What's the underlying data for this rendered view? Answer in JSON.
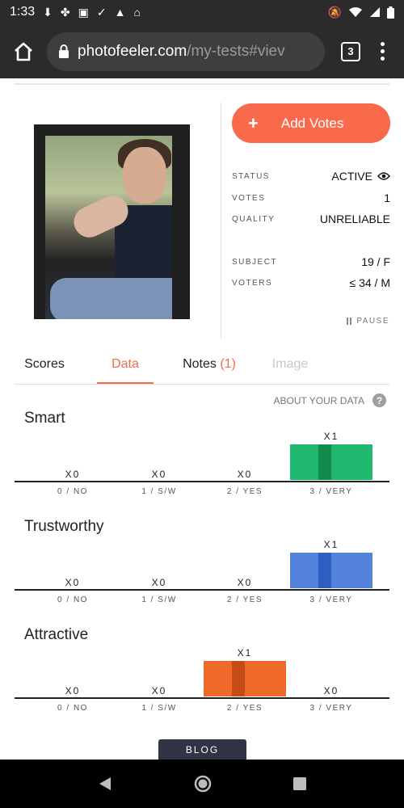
{
  "statusbar": {
    "time": "1:33",
    "icons_left": [
      "download-icon",
      "leaf-icon",
      "image-icon",
      "check-icon",
      "warning-icon",
      "vpn-icon"
    ],
    "icons_right": [
      "mute-icon",
      "wifi-icon",
      "signal-icon",
      "battery-icon"
    ]
  },
  "browser": {
    "url_host": "photofeeler.com",
    "url_path": "/my-tests#viev",
    "tab_count": "3"
  },
  "test": {
    "add_votes_label": "Add Votes",
    "status_label": "STATUS",
    "status_value": "ACTIVE",
    "votes_label": "VOTES",
    "votes_value": "1",
    "quality_label": "QUALITY",
    "quality_value": "UNRELIABLE",
    "subject_label": "SUBJECT",
    "subject_value": "19 / F",
    "voters_label": "VOTERS",
    "voters_value": "≤ 34 / M",
    "pause_label": "PAUSE"
  },
  "tabs": {
    "scores": "Scores",
    "data": "Data",
    "notes": "Notes",
    "notes_count": "(1)",
    "image": "Image"
  },
  "about_data": "ABOUT YOUR DATA",
  "chart_data": [
    {
      "type": "bar",
      "title": "Smart",
      "categories": [
        "0 / NO",
        "1 / S/W",
        "2 / YES",
        "3 / VERY"
      ],
      "values": [
        0,
        0,
        0,
        1
      ],
      "labels": [
        "X0",
        "X0",
        "X0",
        "X1"
      ],
      "color": "#1fb86e",
      "stripe": "#128a4e"
    },
    {
      "type": "bar",
      "title": "Trustworthy",
      "categories": [
        "0 / NO",
        "1 / S/W",
        "2 / YES",
        "3 / VERY"
      ],
      "values": [
        0,
        0,
        0,
        1
      ],
      "labels": [
        "X0",
        "X0",
        "X0",
        "X1"
      ],
      "color": "#5282db",
      "stripe": "#2f5fc2"
    },
    {
      "type": "bar",
      "title": "Attractive",
      "categories": [
        "0 / NO",
        "1 / S/W",
        "2 / YES",
        "3 / VERY"
      ],
      "values": [
        0,
        0,
        1,
        0
      ],
      "labels": [
        "X0",
        "X0",
        "X1",
        "X0"
      ],
      "color": "#ef6a2a",
      "stripe": "#c44d15"
    }
  ],
  "blog_label": "BLOG",
  "navbar": {
    "icons": [
      "back-icon",
      "home-icon",
      "recents-icon"
    ]
  }
}
